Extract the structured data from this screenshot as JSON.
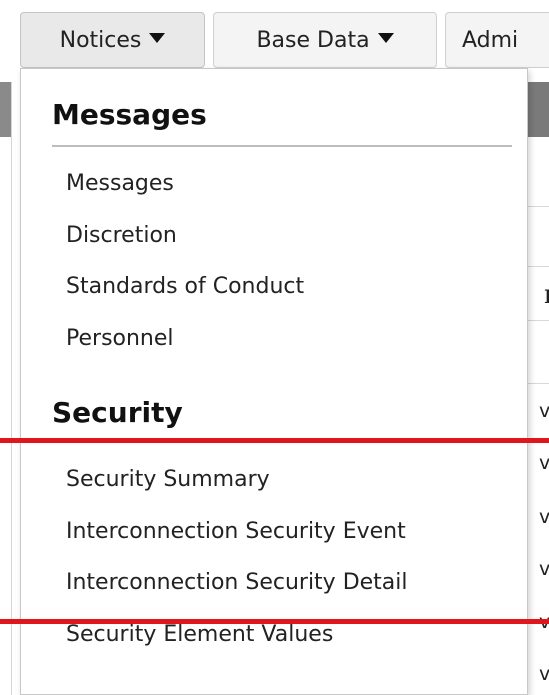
{
  "navbar": {
    "tabs": [
      {
        "label": "Notices",
        "active": true
      },
      {
        "label": "Base Data",
        "active": false
      },
      {
        "label": "Admi",
        "active": false
      }
    ]
  },
  "dropdown": {
    "sections": [
      {
        "heading": "Messages",
        "items": [
          "Messages",
          "Discretion",
          "Standards of Conduct",
          "Personnel"
        ]
      },
      {
        "heading": "Security",
        "items": [
          "Security Summary",
          "Interconnection Security Event",
          "Interconnection Security Detail",
          "Security Element Values"
        ]
      }
    ]
  },
  "background": {
    "right_glyphs": [
      "I",
      "v",
      "v",
      "v",
      "v",
      "v",
      "v"
    ]
  },
  "colors": {
    "annotation": "#e0161f",
    "tab_background": "#f4f4f4",
    "active_tab_background": "#e9e9e9"
  }
}
